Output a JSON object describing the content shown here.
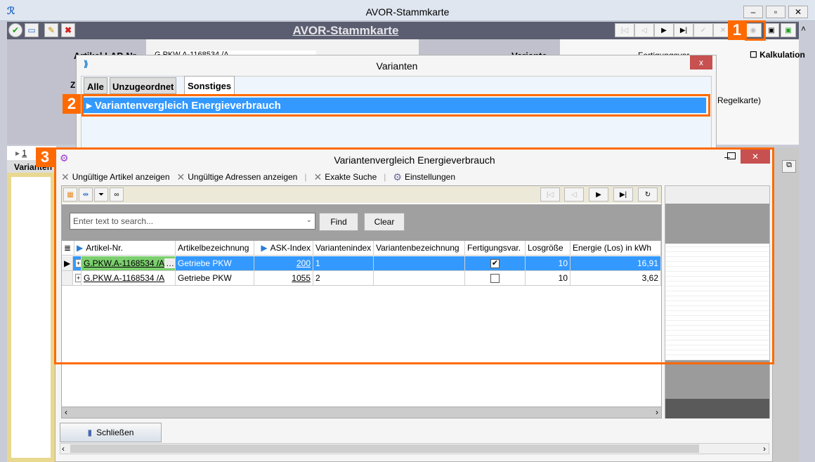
{
  "main_window": {
    "title": "AVOR-Stammkarte",
    "toolbar_title": "AVOR-Stammkarte",
    "bg_labels": {
      "artikel": "Artikel LAP-Nr.",
      "artikel_value": "G.PKW.A-1168534 /A",
      "variante": "Variante",
      "fertigung": "Fertigungsvar.",
      "kalkulation": "Kalkulation",
      "regelkarte": "Regelkarte)",
      "z": "Z",
      "row_nav": "1",
      "varianten_tab": "Varianten"
    }
  },
  "varianten_dialog": {
    "title": "Varianten",
    "tabs": [
      {
        "label": "Alle"
      },
      {
        "label": "Unzugeordnet"
      },
      {
        "label": "Sonstiges",
        "active": true
      }
    ],
    "rows": [
      {
        "label": "Variantenvergleich Energieverbrauch",
        "selected": true
      }
    ]
  },
  "energy_dialog": {
    "title": "Variantenvergleich Energieverbrauch",
    "toolbar": [
      {
        "label": "Ungültige Artikel anzeigen",
        "icon": "x-icon"
      },
      {
        "label": "Ungültige Adressen anzeigen",
        "icon": "x-icon"
      },
      {
        "label": "Exakte Suche",
        "icon": "x-icon"
      },
      {
        "label": "Einstellungen",
        "icon": "gears-icon"
      }
    ],
    "search": {
      "placeholder": "Enter text to search...",
      "find": "Find",
      "clear": "Clear"
    },
    "columns": [
      "Artikel-Nr.",
      "Artikelbezeichnung",
      "ASK-Index",
      "Variantenindex",
      "Variantenbezeichnung",
      "Fertigungsvar.",
      "Losgröße",
      "Energie (Los) in kWh"
    ],
    "rows": [
      {
        "artikel": "G.PKW.A-1168534 /A",
        "bezeichnung": "Getriebe PKW",
        "ask": "200",
        "vindex": "1",
        "vbez": "",
        "fertigung": true,
        "los": "10",
        "energie": "16,91",
        "selected": true
      },
      {
        "artikel": "G.PKW.A-1168534 /A",
        "bezeichnung": "Getriebe PKW",
        "ask": "1055",
        "vindex": "2",
        "vbez": "",
        "fertigung": false,
        "los": "10",
        "energie": "3,62",
        "selected": false
      }
    ],
    "close_button": "Schließen"
  },
  "annotations": [
    "1",
    "2",
    "3"
  ],
  "colors": {
    "accent_orange": "#ff6a00",
    "selection_blue": "#3399ff",
    "toolbar_dark": "#5b5e70",
    "close_red": "#c75050",
    "green_cell": "#7ccf6e"
  }
}
